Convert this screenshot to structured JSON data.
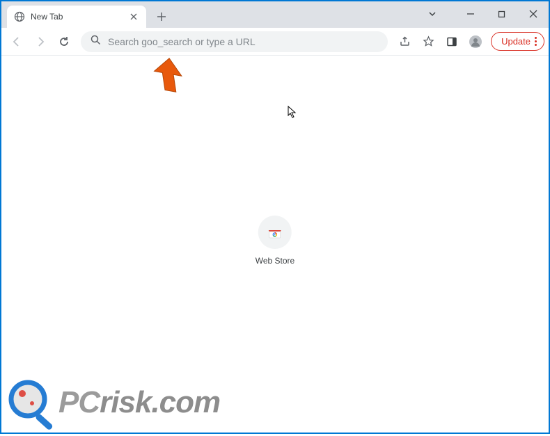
{
  "tab": {
    "title": "New Tab"
  },
  "omnibox": {
    "placeholder": "Search goo_search or type a URL"
  },
  "toolbar": {
    "update_label": "Update"
  },
  "shortcut": {
    "label": "Web Store"
  },
  "watermark": {
    "text_pc": "PC",
    "text_rest": "risk.com"
  }
}
